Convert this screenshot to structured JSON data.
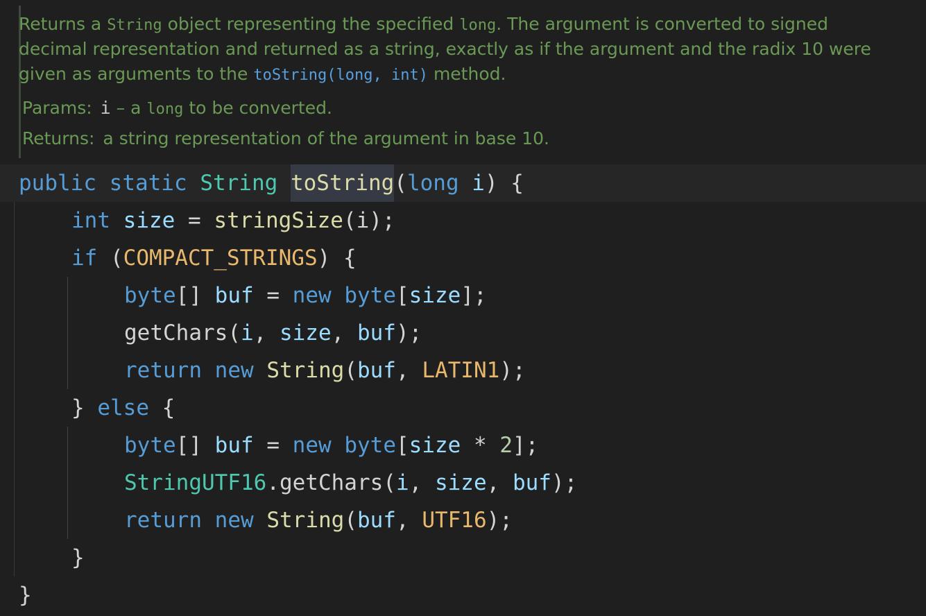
{
  "doc": {
    "line1_a": "Returns a ",
    "line1_code": "String",
    "line1_b": " object representing the specified ",
    "line1_code2": "long",
    "line1_c": ". The argument is converted to signed",
    "line2": "decimal representation and returned as a string, exactly as if the argument and the radix 10 were",
    "line3_a": "given as arguments to the ",
    "line3_link": "toString(long, int)",
    "line3_b": " method.",
    "params_label": "Params:",
    "params_name": "i",
    "params_dash": " – a ",
    "params_code": "long",
    "params_rest": " to be converted.",
    "returns_label": "Returns:",
    "returns_text": "a string representation of the argument in base 10."
  },
  "code": {
    "l1": {
      "public": "public",
      "static": "static",
      "String": "String",
      "name": "toString",
      "paren_open": "(",
      "long": "long",
      "i": "i",
      "rest": ") {"
    },
    "l2": {
      "int": "int",
      "size": "size",
      "eq": " = ",
      "call": "stringSize",
      "args": "(i);"
    },
    "l3": {
      "if": "if",
      "open": " (",
      "const": "COMPACT_STRINGS",
      "close": ") {"
    },
    "l4": {
      "byte": "byte",
      "br": "[] ",
      "buf": "buf",
      "eq": " = ",
      "new": "new",
      "byte2": "byte",
      "ob": "[",
      "size": "size",
      "cb": "];"
    },
    "l5": {
      "fn": "getChars",
      "open": "(",
      "i": "i",
      "c1": ", ",
      "size": "size",
      "c2": ", ",
      "buf": "buf",
      "close": ");"
    },
    "l6": {
      "return": "return",
      "new": "new",
      "String": "String",
      "open": "(",
      "buf": "buf",
      "c": ", ",
      "const": "LATIN1",
      "close": ");"
    },
    "l7": {
      "close": "} ",
      "else": "else",
      "open": " {"
    },
    "l8": {
      "byte": "byte",
      "br": "[] ",
      "buf": "buf",
      "eq": " = ",
      "new": "new",
      "byte2": "byte",
      "ob": "[",
      "size": "size",
      "mul": " * ",
      "two": "2",
      "cb": "];"
    },
    "l9": {
      "type": "StringUTF16",
      "dot": ".",
      "fn": "getChars",
      "open": "(",
      "i": "i",
      "c1": ", ",
      "size": "size",
      "c2": ", ",
      "buf": "buf",
      "close": ");"
    },
    "l10": {
      "return": "return",
      "new": "new",
      "String": "String",
      "open": "(",
      "buf": "buf",
      "c": ", ",
      "const": "UTF16",
      "close": ");"
    },
    "l11": {
      "close": "}"
    },
    "l12": {
      "close": "}"
    }
  },
  "colors": {
    "background": "#1f1f1f",
    "doc_text": "#6a9955",
    "keyword": "#569cd6",
    "type": "#4ec9b0",
    "constant": "#e8b86d",
    "variable": "#9cdcfe"
  }
}
